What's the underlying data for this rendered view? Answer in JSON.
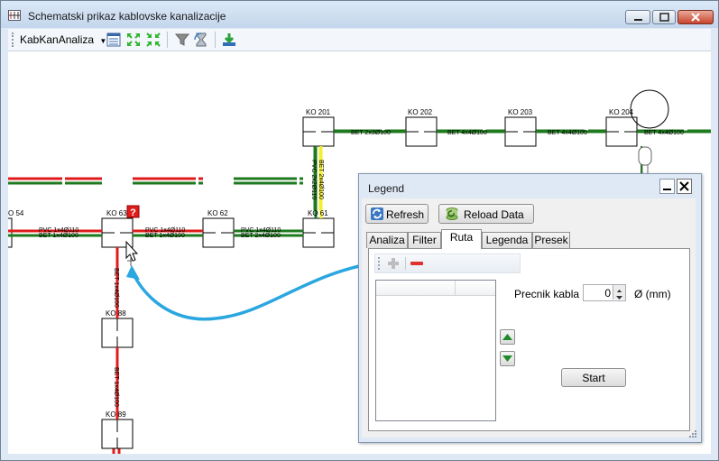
{
  "window": {
    "title": "Schematski prikaz kablovske kanalizacije",
    "controls": {
      "minimize": "minimize",
      "maximize": "maximize",
      "close": "close"
    }
  },
  "toolbar": {
    "menu_label": "KabKanAnaliza",
    "icons": [
      "table-icon",
      "expand-icon",
      "collapse-icon",
      "filter-icon",
      "hourglass-icon",
      "download-icon"
    ]
  },
  "diagram": {
    "nodes": [
      "O 54",
      "KO 63",
      "KO 62",
      "KO 61",
      "KO 201",
      "KO 202",
      "KO 203",
      "KO 204",
      "KO 88",
      "KO 89"
    ],
    "cable_labels": [
      "PVC 1x4Ø110",
      "BET 1x4Ø100",
      "PVC 1x4Ø110",
      "BET 1x4Ø100",
      "PVC 1x4Ø110",
      "BET 2x4Ø100",
      "BET 2x3Ø100",
      "BET 4x4Ø100",
      "BET 4x4Ø100",
      "BET 4x4Ø100",
      "PVC 2x2Ø110",
      "BET 2x4Ø100",
      "BET 1x4Ø100",
      "BET 1x4Ø100"
    ],
    "warning_badge": "?",
    "colors": {
      "green": "#1e7a1e",
      "red": "#e01b1b",
      "yellow": "#f2ef2b",
      "arrow": "#2aa6e0"
    }
  },
  "legend": {
    "title": "Legend",
    "refresh_label": "Refresh",
    "reload_label": "Reload Data",
    "tabs": [
      {
        "label": "Analiza",
        "active": false
      },
      {
        "label": "Filter",
        "active": false
      },
      {
        "label": "Ruta",
        "active": true
      },
      {
        "label": "Legenda",
        "active": false
      },
      {
        "label": "Presek",
        "active": false
      }
    ],
    "ruta": {
      "cable_diameter_label": "Precnik kabla",
      "cable_diameter_value": "0",
      "unit_label": "Ø (mm)",
      "start_label": "Start"
    }
  }
}
